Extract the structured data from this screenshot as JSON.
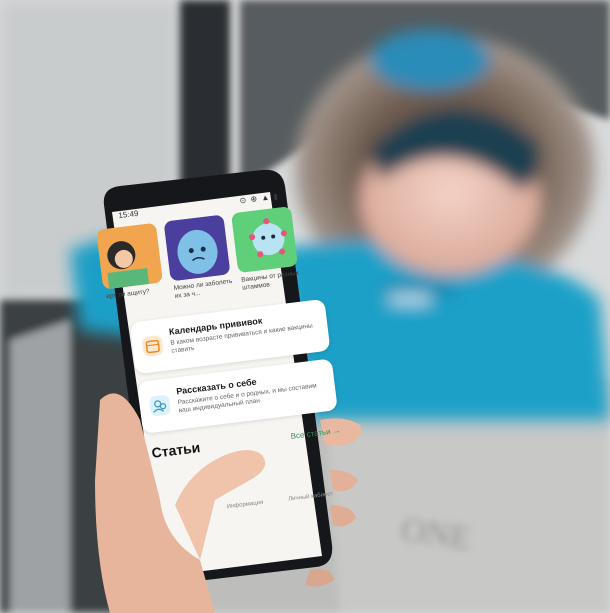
{
  "status_bar": {
    "time": "15:49",
    "icons": "⊙ ⊕ ▲ ▮"
  },
  "stories": [
    {
      "caption": "ерт ли ащиту?"
    },
    {
      "caption": "Можно ли заболеть их за ч..."
    },
    {
      "caption": "Вакцины от разных штаммов"
    }
  ],
  "cards": [
    {
      "title": "Календарь прививок",
      "subtitle": "В каком возрасте прививаться и какие вакцины ставить"
    },
    {
      "title": "Рассказать о себе",
      "subtitle": "Расскажите о себе и о родных, и мы составим ваш индивидуальный план"
    }
  ],
  "articles": {
    "heading": "Статьи",
    "all_link": "Все статьи →"
  },
  "bottom_nav": {
    "items": [
      "Информация",
      "Личный кабинет"
    ]
  },
  "colors": {
    "accent_green": "#3a8f5c",
    "jacket_blue": "#1aa0c8",
    "story_purple": "#4b3f9e"
  }
}
